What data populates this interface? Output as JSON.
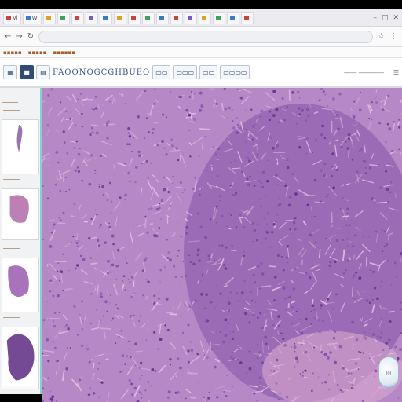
{
  "browser": {
    "tabs": [
      {
        "label": "Vi",
        "color": "#c9453a"
      },
      {
        "label": "Wi",
        "color": "#3a7bc9"
      },
      {
        "label": "",
        "color": "#e0a020"
      },
      {
        "label": "",
        "color": "#3aa55a"
      },
      {
        "label": "",
        "color": "#c9453a"
      },
      {
        "label": "",
        "color": "#7a5ac9"
      },
      {
        "label": "",
        "color": "#3a7bc9"
      },
      {
        "label": "",
        "color": "#e0a020"
      },
      {
        "label": "",
        "color": "#c9453a"
      },
      {
        "label": "",
        "color": "#3aa55a"
      },
      {
        "label": "",
        "color": "#3a7bc9"
      },
      {
        "label": "",
        "color": "#c9453a"
      },
      {
        "label": "",
        "color": "#7a5ac9"
      },
      {
        "label": "",
        "color": "#e0a020"
      },
      {
        "label": "",
        "color": "#3aa55a"
      },
      {
        "label": "",
        "color": "#3a7bc9"
      },
      {
        "label": "",
        "color": "#c9453a"
      }
    ],
    "window_controls": [
      "–",
      "□",
      "✕"
    ],
    "nav": {
      "back": "←",
      "forward": "→",
      "reload": "↻"
    },
    "url": "",
    "bookmarks": [
      "▪▪▪▪▪",
      "▪▪▪▪▪",
      "▪▪▪▪▪▪"
    ]
  },
  "viewer_toolbar": {
    "tools": [
      {
        "icon": "▦",
        "style": "plain"
      },
      {
        "icon": "■",
        "style": "dark"
      },
      {
        "icon": "▤",
        "style": "plain"
      }
    ],
    "title": "FAOONOGCGHBUEO",
    "buttons": [
      "▭▭",
      "▭▭▭",
      "▭▭",
      "▭▭▭▭"
    ],
    "right_text": "―― ――――",
    "right_icon": "☰"
  },
  "sidebar": {
    "header": "―――",
    "thumbnails": [
      {
        "label": "―――",
        "tone": "#8a5aa0"
      },
      {
        "label": "―――",
        "tone": "#b06aa8"
      },
      {
        "label": "―――",
        "tone": "#9a5ab0"
      },
      {
        "label": "―――",
        "tone": "#5a2a80"
      }
    ],
    "footer": "――――"
  },
  "slide": {
    "stain_base": "#b688c6",
    "stain_dark": "#6a3a94",
    "stain_light": "#e8c8e8"
  },
  "zoom_dial_icon": "◎"
}
